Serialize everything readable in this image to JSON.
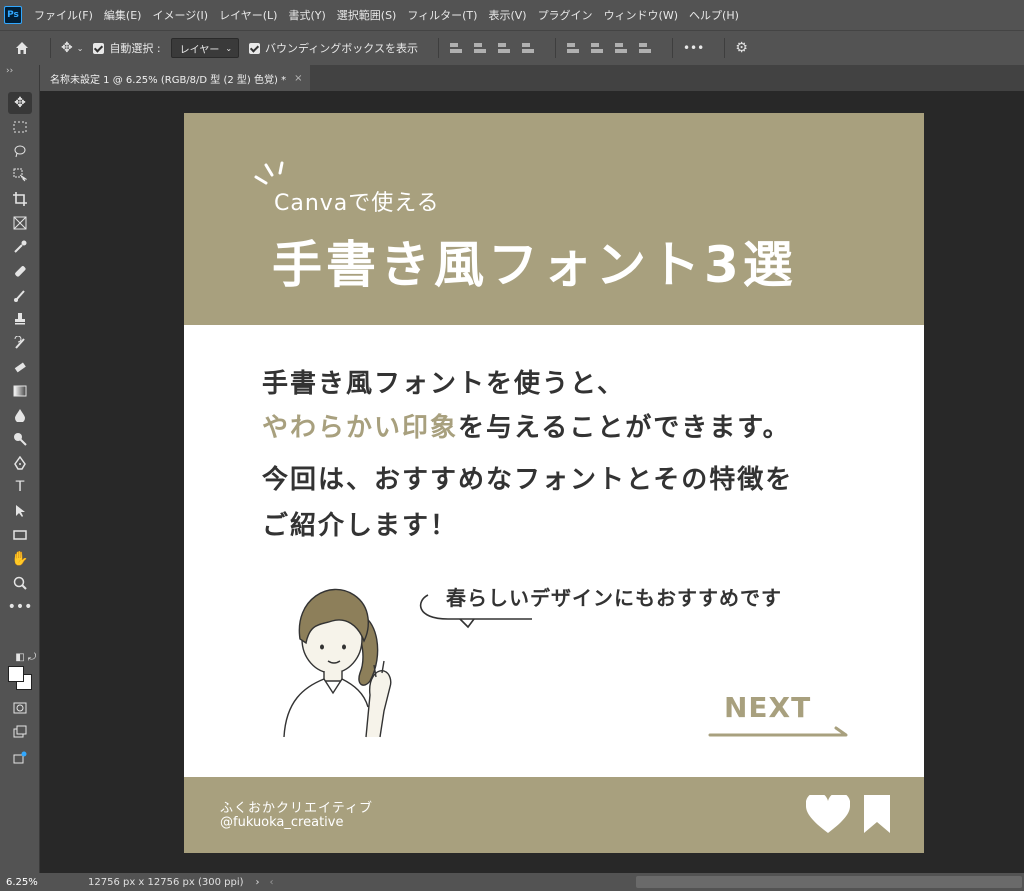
{
  "app": {
    "logo": "Ps"
  },
  "menu": [
    "ファイル(F)",
    "編集(E)",
    "イメージ(I)",
    "レイヤー(L)",
    "書式(Y)",
    "選択範囲(S)",
    "フィルター(T)",
    "表示(V)",
    "プラグイン",
    "ウィンドウ(W)",
    "ヘルプ(H)"
  ],
  "options": {
    "auto_select_label": "自動選択 :",
    "auto_select_value": "レイヤー",
    "bounding_box_label": "バウンディングボックスを表示",
    "more": "•••"
  },
  "tab": {
    "title": "名称未設定 1 @ 6.25% (RGB/8/D 型 (2 型) 色覚) *",
    "close": "×"
  },
  "canvas": {
    "subtitle": "Canvaで使える",
    "title": "手書き風フォント3選",
    "line1": "手書き風フォントを使うと、",
    "line2_highlight": "やわらかい印象",
    "line2_rest": "を与えることができます。",
    "line3": "今回は、おすすめなフォントとその特徴を",
    "line4": "ご紹介します！",
    "bubble": "春らしいデザインにもおすすめです",
    "next": "NEXT",
    "footer_name": "ふくおかクリエイティブ",
    "footer_handle": "@fukuoka_creative",
    "colors": {
      "accent": "#a8a07e",
      "text": "#333333"
    }
  },
  "status": {
    "zoom": "6.25%",
    "doc_size": "12756 px x 12756 px (300 ppi)",
    "nav": "›"
  }
}
